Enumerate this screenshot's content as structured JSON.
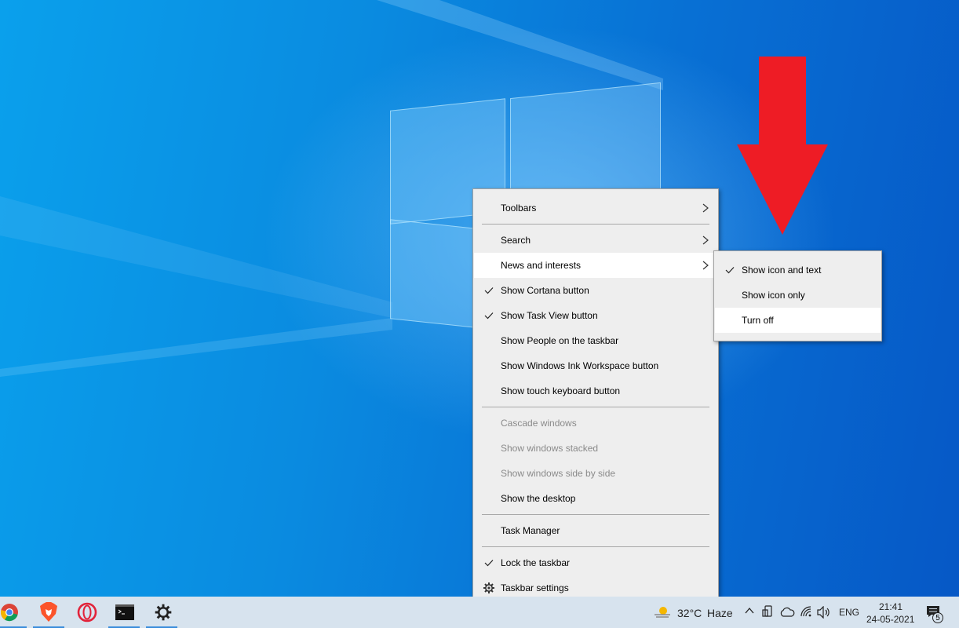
{
  "context_menu": {
    "items": [
      {
        "label": "Toolbars",
        "has_submenu": true
      },
      {
        "label": "Search",
        "has_submenu": true
      },
      {
        "label": "News and interests",
        "has_submenu": true,
        "highlighted": true
      },
      {
        "label": "Show Cortana button",
        "checked": true
      },
      {
        "label": "Show Task View button",
        "checked": true
      },
      {
        "label": "Show People on the taskbar"
      },
      {
        "label": "Show Windows Ink Workspace button"
      },
      {
        "label": "Show touch keyboard button"
      },
      {
        "label": "Cascade windows",
        "disabled": true
      },
      {
        "label": "Show windows stacked",
        "disabled": true
      },
      {
        "label": "Show windows side by side",
        "disabled": true
      },
      {
        "label": "Show the desktop"
      },
      {
        "label": "Task Manager"
      },
      {
        "label": "Lock the taskbar",
        "checked": true
      },
      {
        "label": "Taskbar settings",
        "icon": "gear-icon"
      }
    ]
  },
  "submenu": {
    "items": [
      {
        "label": "Show icon and text",
        "checked": true
      },
      {
        "label": "Show icon only"
      },
      {
        "label": "Turn off",
        "highlighted": true
      }
    ]
  },
  "annotation": {
    "icon": "red-down-arrow",
    "color": "#ee1c25"
  },
  "taskbar": {
    "apps": [
      {
        "name": "chrome-icon"
      },
      {
        "name": "brave-icon"
      },
      {
        "name": "opera-icon"
      },
      {
        "name": "terminal-icon"
      },
      {
        "name": "settings-gear-icon"
      }
    ],
    "weather": {
      "temperature": "32°C",
      "condition": "Haze"
    },
    "language": "ENG",
    "time": "21:41",
    "date": "24-05-2021",
    "notification_count": "5",
    "accent_color": "#3a8ddb"
  }
}
